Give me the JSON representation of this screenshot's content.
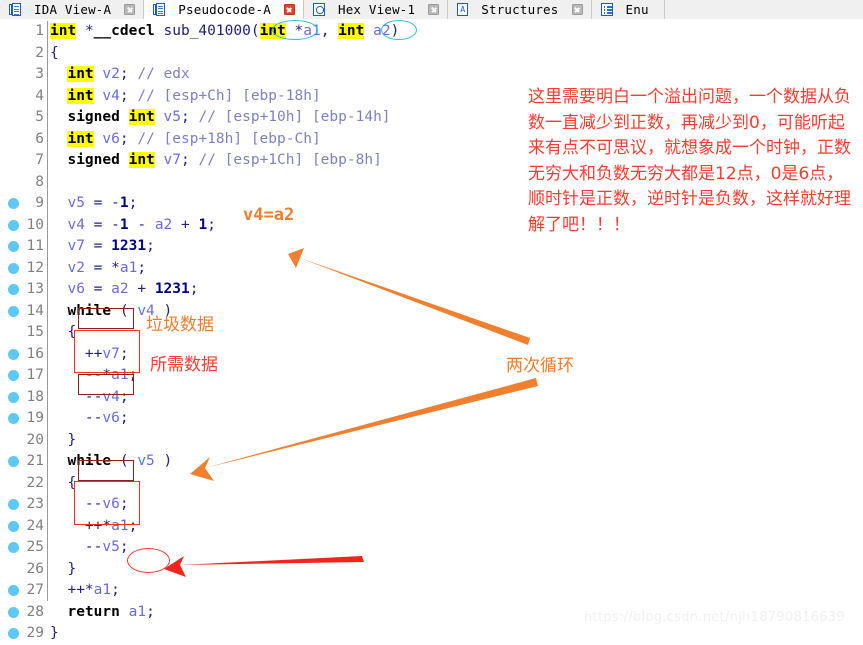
{
  "window": {
    "tabs": [
      {
        "label": "IDA View-A",
        "icon": "document-icon",
        "active": false,
        "close_icon": "close-icon",
        "close_red": false
      },
      {
        "label": "Pseudocode-A",
        "icon": "document-icon",
        "active": true,
        "close_icon": "close-icon",
        "close_red": true
      },
      {
        "label": "Hex View-1",
        "icon": "hex-view-icon",
        "active": false,
        "close_icon": "close-icon",
        "close_red": false
      },
      {
        "label": "Structures",
        "icon": "structures-icon",
        "active": false,
        "close_icon": "close-icon",
        "close_red": false
      },
      {
        "label": "Enu",
        "icon": "enums-icon",
        "active": false,
        "close_icon": "close-icon",
        "close_red": false
      }
    ]
  },
  "editor": {
    "breakpoint_color": "#5ec8f5",
    "highlight_color": "#ffff00",
    "lines": [
      {
        "n": 1,
        "bp": false,
        "text": "int *__cdecl sub_401000(int *a1, int a2)"
      },
      {
        "n": 2,
        "bp": false,
        "text": "{"
      },
      {
        "n": 3,
        "bp": false,
        "text": "  int v2; // edx"
      },
      {
        "n": 4,
        "bp": false,
        "text": "  int v4; // [esp+Ch] [ebp-18h]"
      },
      {
        "n": 5,
        "bp": false,
        "text": "  signed int v5; // [esp+10h] [ebp-14h]"
      },
      {
        "n": 6,
        "bp": false,
        "text": "  int v6; // [esp+18h] [ebp-Ch]"
      },
      {
        "n": 7,
        "bp": false,
        "text": "  signed int v7; // [esp+1Ch] [ebp-8h]"
      },
      {
        "n": 8,
        "bp": false,
        "text": ""
      },
      {
        "n": 9,
        "bp": true,
        "text": "  v5 = -1;"
      },
      {
        "n": 10,
        "bp": true,
        "text": "  v4 = -1 - a2 + 1;"
      },
      {
        "n": 11,
        "bp": true,
        "text": "  v7 = 1231;"
      },
      {
        "n": 12,
        "bp": true,
        "text": "  v2 = *a1;"
      },
      {
        "n": 13,
        "bp": true,
        "text": "  v6 = a2 + 1231;"
      },
      {
        "n": 14,
        "bp": true,
        "text": "  while ( v4 )"
      },
      {
        "n": 15,
        "bp": false,
        "text": "  {"
      },
      {
        "n": 16,
        "bp": true,
        "text": "    ++v7;"
      },
      {
        "n": 17,
        "bp": true,
        "text": "    --*a1;"
      },
      {
        "n": 18,
        "bp": true,
        "text": "    --v4;"
      },
      {
        "n": 19,
        "bp": true,
        "text": "    --v6;"
      },
      {
        "n": 20,
        "bp": false,
        "text": "  }"
      },
      {
        "n": 21,
        "bp": true,
        "text": "  while ( v5 )"
      },
      {
        "n": 22,
        "bp": false,
        "text": "  {"
      },
      {
        "n": 23,
        "bp": true,
        "text": "    --v6;"
      },
      {
        "n": 24,
        "bp": true,
        "text": "    ++*a1;"
      },
      {
        "n": 25,
        "bp": true,
        "text": "    --v5;"
      },
      {
        "n": 26,
        "bp": false,
        "text": "  }"
      },
      {
        "n": 27,
        "bp": true,
        "text": "  ++*a1;"
      },
      {
        "n": 28,
        "bp": true,
        "text": "  return a1;"
      },
      {
        "n": 29,
        "bp": true,
        "text": "}"
      }
    ]
  },
  "annotations": {
    "red_note": "这里需要明白一个溢出问题，一个数据从负数一直减少到正数，再减少到0，可能听起来有点不可思议，就想象成一个时钟，正数无穷大和负数无穷大都是12点，0是6点，顺时针是正数，逆时针是负数，这样就好理解了吧！！！",
    "red_note_color": "#ff3b30",
    "v4_eq_a2": "v4=a2",
    "garbage_data": "垃圾数据",
    "needed_data": "所需数据",
    "two_loops": "两次循环",
    "orange_color": "#f07d2b"
  },
  "watermark": "https://blog.csdn.net/njh18790816639"
}
